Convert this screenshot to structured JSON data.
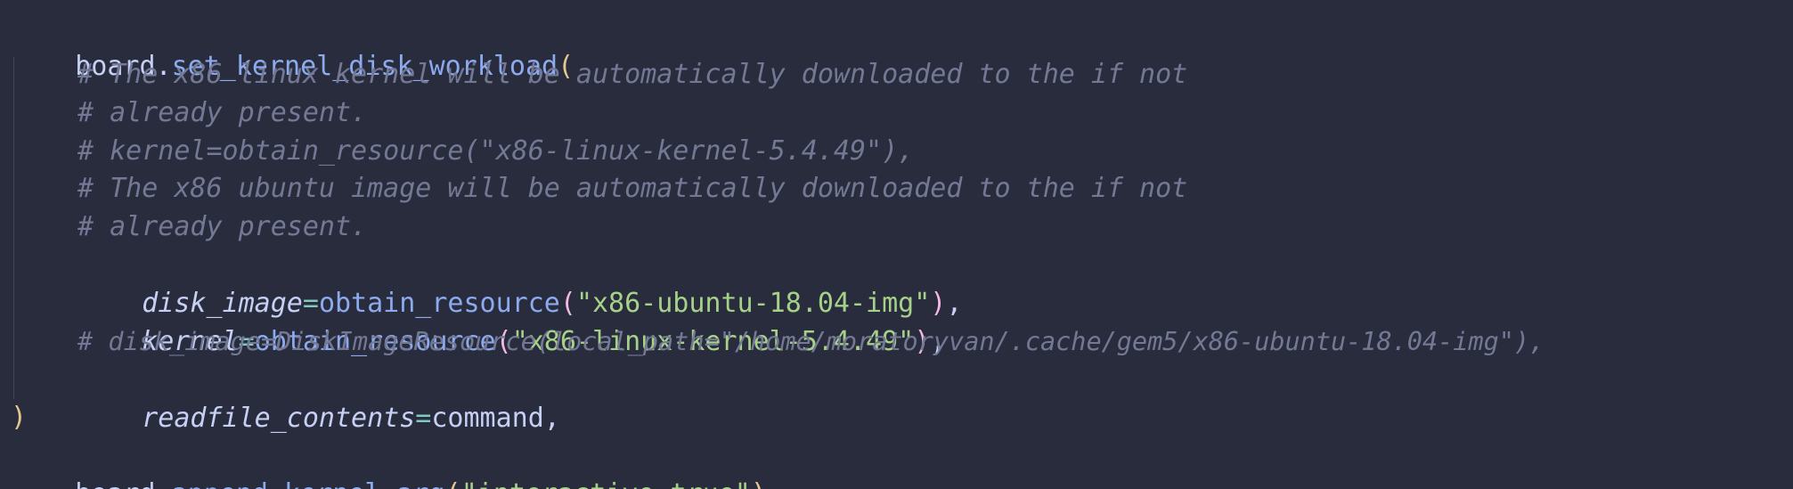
{
  "code": {
    "l1": {
      "obj": "board",
      "dot": ".",
      "fn": "set_kernel_disk_workload",
      "open": "("
    },
    "l2": "# The x86 linux kernel will be automatically downloaded to the if not",
    "l3": "# already present.",
    "l4": "# kernel=obtain_resource(\"x86-linux-kernel-5.4.49\"),",
    "l5": "# The x86 ubuntu image will be automatically downloaded to the if not",
    "l6": "# already present.",
    "l7": {
      "param": "disk_image",
      "eq": "=",
      "fn": "obtain_resource",
      "open": "(",
      "str": "\"x86-ubuntu-18.04-img\"",
      "close": ")",
      "comma": ","
    },
    "l8": {
      "param": "kernel",
      "eq": "=",
      "fn": "obtain_resource",
      "open": "(",
      "str": "\"x86-linux-kernel-5.4.49\"",
      "close": ")",
      "comma": ","
    },
    "l9": "# disk_image=DiskImageResource(local_path=\"/home/moratoryvan/.cache/gem5/x86-ubuntu-18.04-img\"),",
    "l10": {
      "param": "readfile_contents",
      "eq": "=",
      "val": "command",
      "comma": ","
    },
    "l11": ")",
    "l12": {
      "obj": "board",
      "dot": ".",
      "fn": "append_kernel_arg",
      "open": "(",
      "str": "\"interactive=true\"",
      "close": ")"
    }
  },
  "colors": {
    "background": "#292c3c",
    "text": "#c6d0f5",
    "comment": "#737994",
    "function": "#8caaee",
    "string": "#a6d189",
    "paren_outer": "#e5c890",
    "paren_inner": "#f4b8e4",
    "operator": "#81c8be"
  }
}
